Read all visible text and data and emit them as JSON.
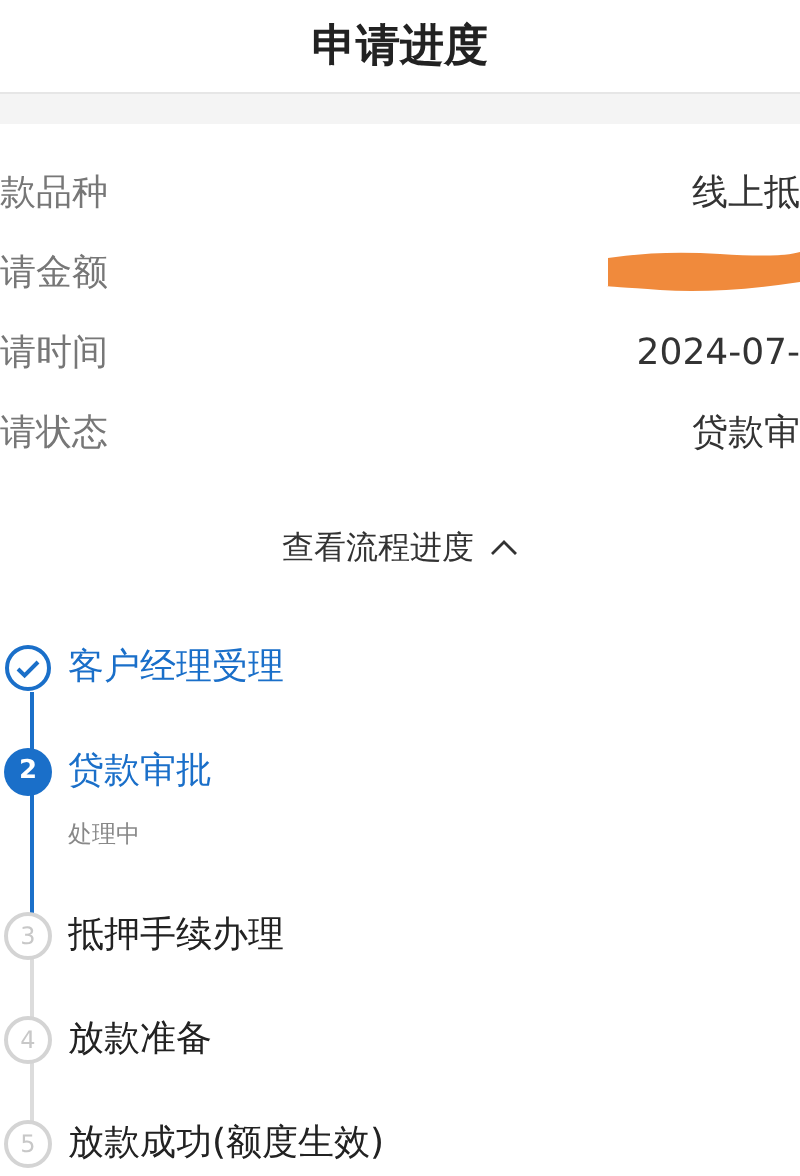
{
  "title": "申请进度",
  "details": [
    {
      "label": "款品种",
      "value": "线上抵"
    },
    {
      "label": "请金额",
      "redacted": true
    },
    {
      "label": "请时间",
      "value": "2024-07-"
    },
    {
      "label": "请状态",
      "value": "贷款审"
    }
  ],
  "toggle": {
    "label": "查看流程进度",
    "expanded": true
  },
  "steps": [
    {
      "name": "客户经理受理",
      "kind": "done"
    },
    {
      "number": "2",
      "name": "贷款审批",
      "kind": "current",
      "note": "处理中"
    },
    {
      "number": "3",
      "name": "抵押手续办理",
      "kind": "pending"
    },
    {
      "number": "4",
      "name": "放款准备",
      "kind": "pending"
    },
    {
      "number": "5",
      "name": "放款成功(额度生效)",
      "kind": "pending"
    }
  ]
}
